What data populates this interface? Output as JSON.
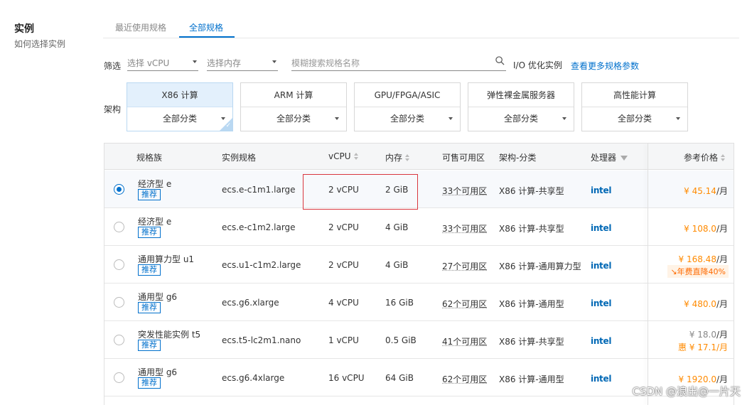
{
  "sidebar": {
    "title": "实例",
    "help_link": "如何选择实例"
  },
  "tabs": [
    {
      "label": "最近使用规格",
      "active": false
    },
    {
      "label": "全部规格",
      "active": true
    }
  ],
  "filters": {
    "label": "筛选",
    "vcpu_placeholder": "选择 vCPU",
    "memory_placeholder": "选择内存",
    "search_placeholder": "模糊搜索规格名称",
    "io_optimized": "I/O 优化实例",
    "more_params": "查看更多规格参数"
  },
  "arch": {
    "label": "架构",
    "options": [
      {
        "name": "X86 计算",
        "category": "全部分类",
        "active": true
      },
      {
        "name": "ARM 计算",
        "category": "全部分类",
        "active": false
      },
      {
        "name": "GPU/FPGA/ASIC",
        "category": "全部分类",
        "active": false
      },
      {
        "name": "弹性裸金属服务器",
        "category": "全部分类",
        "active": false
      },
      {
        "name": "高性能计算",
        "category": "全部分类",
        "active": false
      }
    ]
  },
  "table": {
    "headers": {
      "family": "规格族",
      "spec": "实例规格",
      "vcpu": "vCPU",
      "memory": "内存",
      "zones": "可售可用区",
      "arch": "架构-分类",
      "cpu": "处理器",
      "price": "参考价格"
    },
    "rows": [
      {
        "family": "经济型 e",
        "badge": "推荐",
        "spec": "ecs.e-c1m1.large",
        "vcpu": "2 vCPU",
        "memory": "2 GiB",
        "zones": "33个可用区",
        "arch": "X86 计算-共享型",
        "cpu": "intel",
        "price": "¥ 45.14",
        "unit": "/月",
        "selected": true
      },
      {
        "family": "经济型 e",
        "badge": "推荐",
        "spec": "ecs.e-c1m2.large",
        "vcpu": "2 vCPU",
        "memory": "4 GiB",
        "zones": "33个可用区",
        "arch": "X86 计算-共享型",
        "cpu": "intel",
        "price": "¥ 108.0",
        "unit": "/月",
        "selected": false
      },
      {
        "family": "通用算力型 u1",
        "badge": "推荐",
        "spec": "ecs.u1-c1m2.large",
        "vcpu": "2 vCPU",
        "memory": "4 GiB",
        "zones": "27个可用区",
        "arch": "X86 计算-通用算力型",
        "cpu": "intel",
        "price": "¥ 168.48",
        "unit": "/月",
        "promo": "年费直降40%",
        "selected": false
      },
      {
        "family": "通用型 g6",
        "badge": "推荐",
        "spec": "ecs.g6.xlarge",
        "vcpu": "4 vCPU",
        "memory": "16 GiB",
        "zones": "62个可用区",
        "arch": "X86 计算-通用型",
        "cpu": "intel",
        "price": "¥ 480.0",
        "unit": "/月",
        "selected": false
      },
      {
        "family": "突发性能实例 t5",
        "badge": "推荐",
        "spec": "ecs.t5-lc2m1.nano",
        "vcpu": "1 vCPU",
        "memory": "0.5 GiB",
        "zones": "41个可用区",
        "arch": "X86 计算-共享型",
        "cpu": "intel",
        "price": "¥ 18.0",
        "unit": "/月",
        "price2": "惠 ¥ 17.1",
        "unit2": "/月",
        "selected": false
      },
      {
        "family": "通用型 g6",
        "badge": "推荐",
        "spec": "ecs.g6.4xlarge",
        "vcpu": "16 vCPU",
        "memory": "64 GiB",
        "zones": "62个可用区",
        "arch": "X86 计算-通用型",
        "cpu": "intel",
        "price": "¥ 1920.0",
        "unit": "/月",
        "selected": false
      }
    ]
  },
  "watermark": "CSDN @浪出@一片天"
}
